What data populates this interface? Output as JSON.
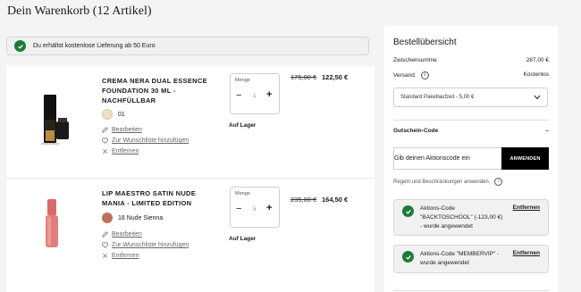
{
  "page": {
    "title": "Dein Warenkorb (12 Artikel)"
  },
  "notice": {
    "text": "Du erhältst kostenlose Lieferung ab 50 Euro"
  },
  "items": [
    {
      "name": "CREMA NERA DUAL ESSENCE FOUNDATION 30 ML - NACHFÜLLBAR",
      "shade": "01",
      "shade_color": "#eedfc4",
      "edit": "Bearbeiten",
      "wishlist": "Zur Wunschliste hinzufügen",
      "remove": "Entfernen",
      "qty_label": "Menge",
      "qty": "1",
      "stock": "Auf Lager",
      "old_price": "175,00 €",
      "new_price": "122,50 €"
    },
    {
      "name": "LIP MAESTRO SATIN NUDE MANIA - LIMITED EDITION",
      "shade": "18 Nude Sienna",
      "shade_color": "#c0705a",
      "edit": "Bearbeiten",
      "wishlist": "Zur Wunschliste hinzufügen",
      "remove": "Entfernen",
      "qty_label": "Menge",
      "qty": "5",
      "stock": "Auf Lager",
      "old_price": "235,00 €",
      "new_price": "164,50 €"
    }
  ],
  "summary": {
    "title": "Bestellübersicht",
    "subtotal_label": "Zwischensumme",
    "subtotal_value": "287,00 €",
    "shipping_label": "Versand",
    "shipping_value": "Kostenlos",
    "shipping_option": "Standard Paketlaufzeit - 5,00 €",
    "voucher_label": "Gutschein-Code",
    "voucher_toggle": "–",
    "code_placeholder": "Gib deinen Aktionscode ein",
    "apply_label": "ANWENDEN",
    "rules_text": "Regeln und Beschränkungen anwenden.",
    "promos": [
      {
        "text": "Aktions-Code \"BACKTOSCHOOL\" (-123,00 €) - wurde angewendet",
        "remove": "Entfernen"
      },
      {
        "text": "Aktions-Code \"MEMBERVIP\" - wurde angewendet",
        "remove": "Entfernen"
      }
    ]
  },
  "colors": {
    "check_green": "#1f7a3a",
    "button_black": "#000000"
  }
}
